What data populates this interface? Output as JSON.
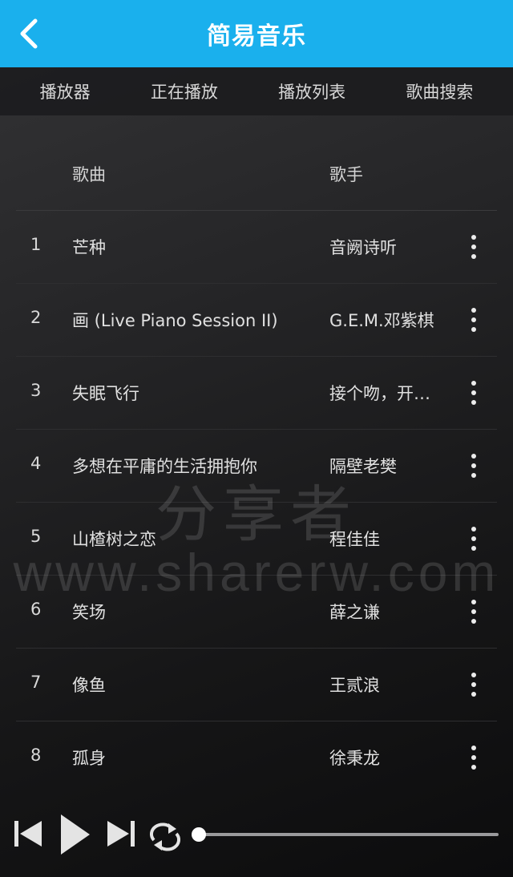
{
  "header": {
    "title": "简易音乐",
    "back_icon": "chevron-left-icon"
  },
  "tabs": [
    {
      "label": "播放器"
    },
    {
      "label": "正在播放"
    },
    {
      "label": "播放列表"
    },
    {
      "label": "歌曲搜索"
    }
  ],
  "list": {
    "columns": {
      "song": "歌曲",
      "artist": "歌手"
    },
    "rows": [
      {
        "num": "1",
        "song": "芒种",
        "artist": "音阙诗听"
      },
      {
        "num": "2",
        "song": "画 (Live Piano Session II)",
        "artist": "G.E.M.邓紫棋"
      },
      {
        "num": "3",
        "song": "失眠飞行",
        "artist": "接个吻，开…"
      },
      {
        "num": "4",
        "song": "多想在平庸的生活拥抱你",
        "artist": "隔壁老樊"
      },
      {
        "num": "5",
        "song": "山楂树之恋",
        "artist": "程佳佳"
      },
      {
        "num": "6",
        "song": "笑场",
        "artist": "薛之谦"
      },
      {
        "num": "7",
        "song": "像鱼",
        "artist": "王贰浪"
      },
      {
        "num": "8",
        "song": "孤身",
        "artist": "徐秉龙"
      }
    ]
  },
  "watermark": {
    "line1": "分享者",
    "line2": "www.sharerw.com"
  },
  "player": {
    "progress": 0
  },
  "colors": {
    "header_bg": "#1ab0ed",
    "text": "#d8d8d8"
  }
}
